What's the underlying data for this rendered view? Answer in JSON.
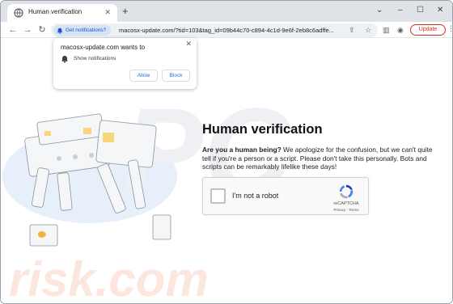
{
  "tab": {
    "title": "Human verification",
    "close": "✕",
    "new_tab": "+"
  },
  "window_controls": {
    "chevron": "⌄",
    "minimize": "–",
    "maximize": "☐",
    "close": "✕"
  },
  "toolbar": {
    "back": "←",
    "forward": "→",
    "reload": "↻",
    "permission_chip": "Get notifications?",
    "url": "macosx-update.com/?tid=103&tag_id=09b44c70-c894-4c1d-9e6f-2eb8c6adffe...",
    "update_label": "Update"
  },
  "notification_popup": {
    "title": "macosx-update.com wants to",
    "description": "Show notifications",
    "allow_label": "Allow",
    "block_label": "Block",
    "close": "✕"
  },
  "page": {
    "title": "Human verification",
    "bold_question": "Are you a human being?",
    "body": " We apologize for the confusion, but we can't quite tell if you're a person or a script. Please don't take this personally. Bots and scripts can be remarkably lifelike these days!"
  },
  "captcha": {
    "label": "I'm not a robot",
    "brand": "reCAPTCHA",
    "links": "Privacy - Terms"
  },
  "watermark": {
    "text": "risk.com"
  },
  "colors": {
    "accent": "#1a73e8",
    "update_red": "#d93025",
    "chip_bg": "#d6e3f7"
  }
}
